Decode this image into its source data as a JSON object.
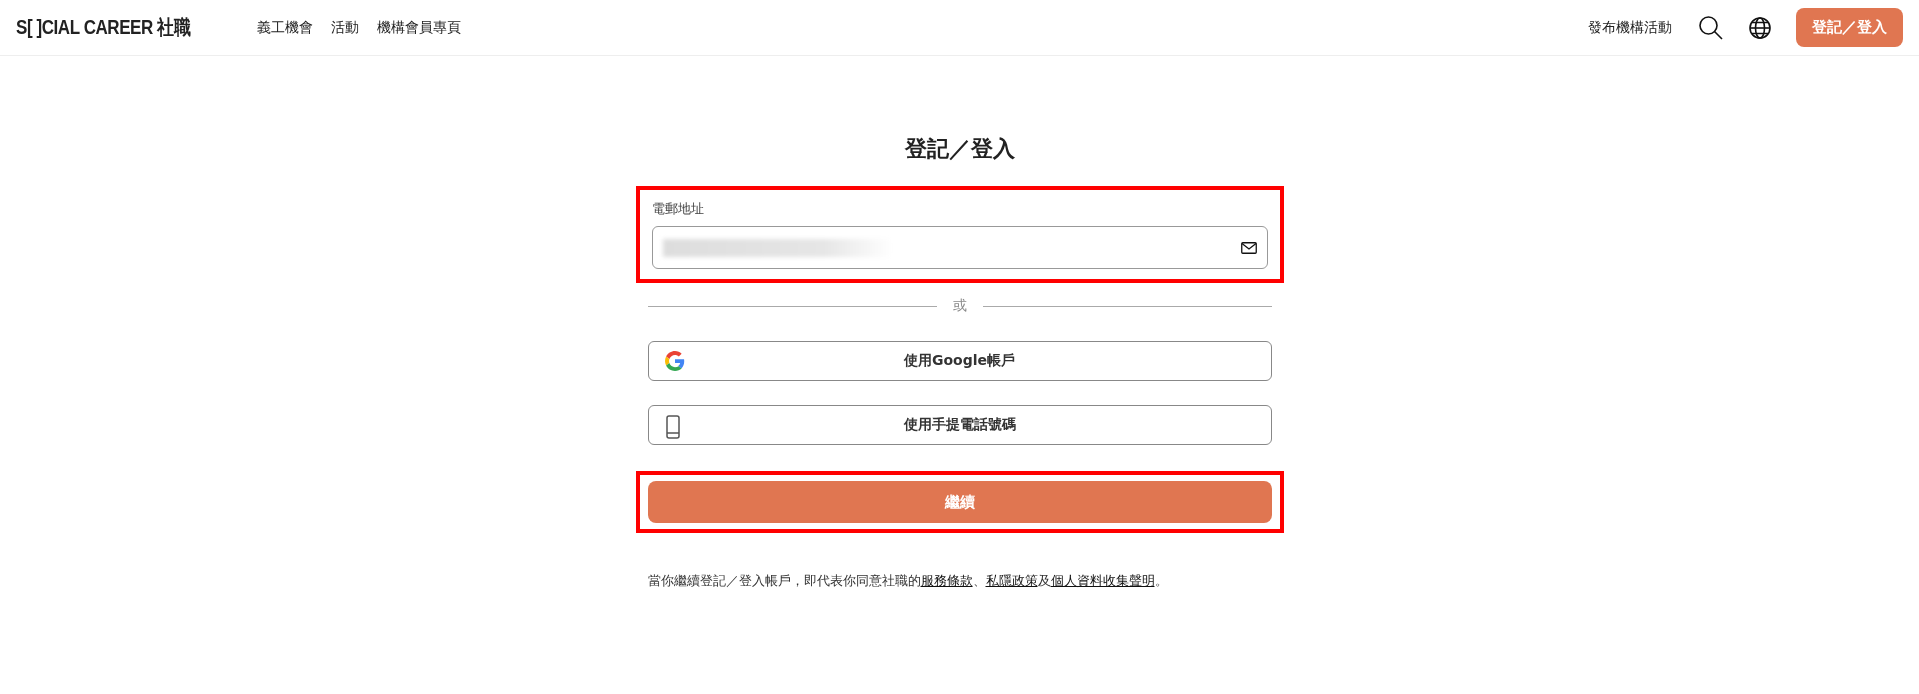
{
  "header": {
    "logo": "S[ ]CIAL CAREER 社職",
    "nav": [
      "義工機會",
      "活動",
      "機構會員專頁"
    ],
    "post_link": "發布機構活動",
    "login_button": "登記／登入"
  },
  "form": {
    "title": "登記／登入",
    "email": {
      "label": "電郵地址",
      "value_redacted": true,
      "highlighted": true
    },
    "divider": "或",
    "options": [
      {
        "kind": "google",
        "label": "使用Google帳戶"
      },
      {
        "kind": "phone",
        "label": "使用手提電話號碼"
      }
    ],
    "continue": {
      "label": "繼續",
      "highlighted": true
    },
    "terms": [
      {
        "kind": "text",
        "text": "當你繼續登記／登入帳戶，即代表你同意社職的"
      },
      {
        "kind": "link",
        "text": "服務條款"
      },
      {
        "kind": "text",
        "text": "、"
      },
      {
        "kind": "link",
        "text": "私隱政策"
      },
      {
        "kind": "text",
        "text": "及"
      },
      {
        "kind": "link",
        "text": "個人資料收集聲明"
      },
      {
        "kind": "text",
        "text": "。"
      }
    ]
  }
}
